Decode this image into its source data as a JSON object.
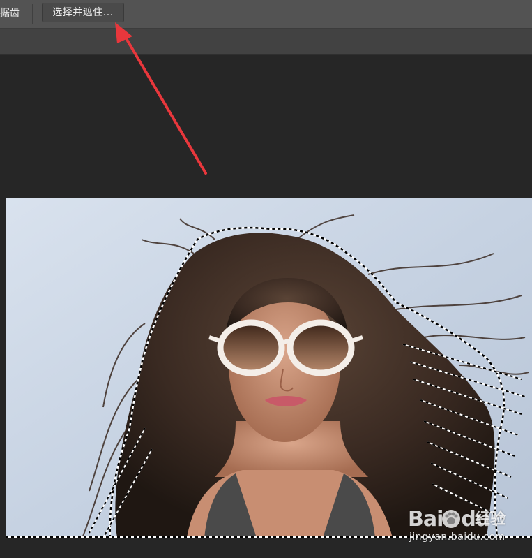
{
  "options_bar": {
    "antialias_label": "据齿",
    "select_and_mask_label": "选择并遮住..."
  },
  "canvas": {
    "background_color": "#262626",
    "image_description_icon": "photo-layer-icon"
  },
  "annotation": {
    "arrow_color": "#e8373c",
    "arrow_icon": "red-callout-arrow-icon"
  },
  "watermark": {
    "logo_text_a": "Bai",
    "logo_text_b": "du",
    "product": "经验",
    "url": "jingyan.baidu.com"
  },
  "colors": {
    "options_bar": "#535353",
    "tab_strip": "#424242",
    "button": "#4a4a4a",
    "button_text": "#ececec"
  }
}
